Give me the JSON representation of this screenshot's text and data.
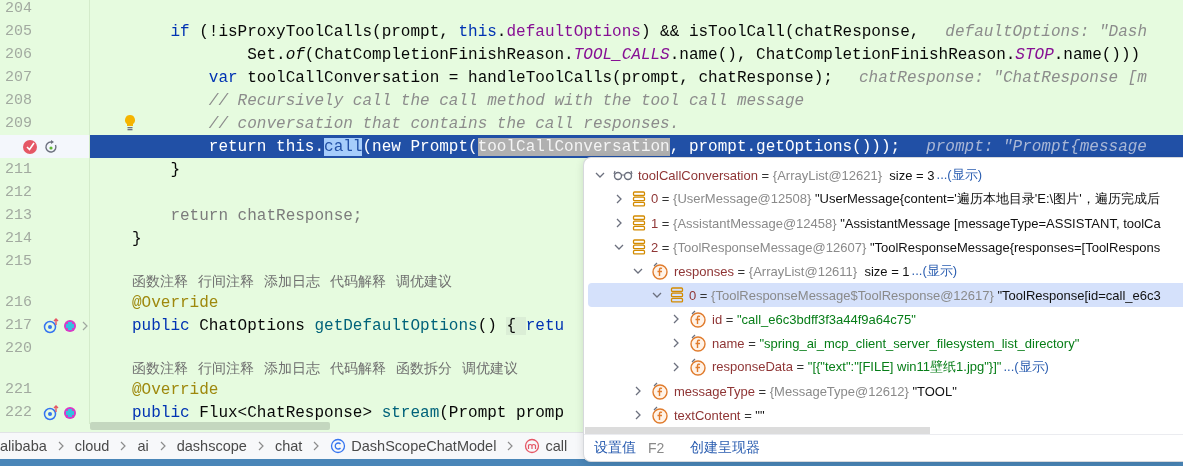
{
  "editor": {
    "lines": [
      {
        "kind": "code",
        "number": "204",
        "current": false
      },
      {
        "kind": "code",
        "number": "205",
        "current": false,
        "tokens": [
          {
            "text": "    if",
            "kind": "keyword"
          },
          {
            "text": " (!isProxyToolCalls(prompt, ",
            "kind": "plain"
          },
          {
            "text": "this",
            "kind": "keyword"
          },
          {
            "text": ".",
            "kind": "plain"
          },
          {
            "text": "defaultOptions",
            "kind": "field"
          },
          {
            "text": ") && isToolCall(chatResponse,",
            "kind": "plain"
          }
        ],
        "hint": "defaultOptions: \"Dash"
      },
      {
        "kind": "code",
        "number": "206",
        "current": false,
        "tokens": [
          {
            "text": "            Set.",
            "kind": "plain"
          },
          {
            "text": "of",
            "kind": "static"
          },
          {
            "text": "(ChatCompletionFinishReason.",
            "kind": "plain"
          },
          {
            "text": "TOOL_CALLS",
            "kind": "constant"
          },
          {
            "text": ".name(), ChatCompletionFinishReason.",
            "kind": "plain"
          },
          {
            "text": "STOP",
            "kind": "constant"
          },
          {
            "text": ".name()))",
            "kind": "plain"
          }
        ]
      },
      {
        "kind": "code",
        "number": "207",
        "current": false,
        "tokens": [
          {
            "text": "        var",
            "kind": "keyword"
          },
          {
            "text": " toolCallConversation = handleToolCalls(prompt, chatResponse);",
            "kind": "plain"
          }
        ],
        "hint": "chatResponse: \"ChatResponse [m"
      },
      {
        "kind": "code",
        "number": "208",
        "current": false,
        "tokens": [
          {
            "text": "        // Recursively call the call method with the tool call message",
            "kind": "comment"
          }
        ]
      },
      {
        "kind": "code",
        "number": "209",
        "current": false,
        "bulb": true,
        "tokens": [
          {
            "text": "        // conversation that contains the call responses.",
            "kind": "comment"
          }
        ]
      },
      {
        "kind": "code",
        "current": true,
        "gutter": [
          {
            "kind": "breakpoint"
          },
          {
            "kind": "reset-frame"
          }
        ],
        "tokens": [
          {
            "text": "        return this.",
            "kind": "plain"
          },
          {
            "text": "call",
            "kind": "match"
          },
          {
            "text": "(new Prompt(",
            "kind": "plain"
          },
          {
            "text": "toolCallConversation",
            "kind": "evaluated"
          },
          {
            "text": ", prompt.getOptions()));",
            "kind": "plain"
          }
        ],
        "hint": "prompt: \"Prompt{message"
      },
      {
        "kind": "code",
        "number": "211",
        "current": false,
        "tokens": [
          {
            "text": "    }",
            "kind": "plain"
          }
        ]
      },
      {
        "kind": "code",
        "number": "212",
        "current": false
      },
      {
        "kind": "code",
        "number": "213",
        "current": false,
        "tokens": [
          {
            "text": "    return chatResponse;",
            "kind": "dim"
          }
        ]
      },
      {
        "kind": "code",
        "number": "214",
        "current": false,
        "tokens": [
          {
            "text": "}",
            "kind": "plain"
          }
        ]
      },
      {
        "kind": "code",
        "number": "215",
        "current": false
      },
      {
        "kind": "actions",
        "items": [
          "函数注释",
          "行间注释",
          "添加日志",
          "代码解释",
          "调优建议"
        ]
      },
      {
        "kind": "code",
        "number": "216",
        "current": false,
        "tokens": [
          {
            "text": "@Override",
            "kind": "annotation"
          }
        ]
      },
      {
        "kind": "code",
        "number": "217",
        "current": false,
        "gutter": [
          {
            "kind": "override"
          },
          {
            "kind": "implemented"
          },
          {
            "kind": "fold"
          }
        ],
        "tokens": [
          {
            "text": "public",
            "kind": "keyword"
          },
          {
            "text": " ChatOptions ",
            "kind": "plain"
          },
          {
            "text": "getDefaultOptions",
            "kind": "declaration"
          },
          {
            "text": "() ",
            "kind": "plain"
          },
          {
            "text": "{ ",
            "kind": "folded"
          },
          {
            "text": "retu",
            "kind": "keyword"
          }
        ]
      },
      {
        "kind": "code",
        "number": "220",
        "current": false
      },
      {
        "kind": "actions",
        "items": [
          "函数注释",
          "行间注释",
          "添加日志",
          "代码解释",
          "函数拆分",
          "调优建议"
        ]
      },
      {
        "kind": "code",
        "number": "221",
        "current": false,
        "tokens": [
          {
            "text": "@Override",
            "kind": "annotation"
          }
        ]
      },
      {
        "kind": "code",
        "number": "222",
        "current": false,
        "gutter": [
          {
            "kind": "override"
          },
          {
            "kind": "implemented"
          }
        ],
        "tokens": [
          {
            "text": "public",
            "kind": "keyword"
          },
          {
            "text": " Flux<ChatResponse> ",
            "kind": "plain"
          },
          {
            "text": "stream",
            "kind": "declaration"
          },
          {
            "text": "(Prompt promp",
            "kind": "plain"
          }
        ]
      }
    ]
  },
  "breadcrumbs": [
    {
      "label": "alibaba",
      "kind": "package"
    },
    {
      "label": "cloud",
      "kind": "package"
    },
    {
      "label": "ai",
      "kind": "package"
    },
    {
      "label": "dashscope",
      "kind": "package"
    },
    {
      "label": "chat",
      "kind": "package"
    },
    {
      "label": "DashScopeChatModel",
      "kind": "class"
    },
    {
      "label": "call",
      "kind": "method"
    }
  ],
  "debugger_popup": {
    "tree": [
      {
        "kind": "watch",
        "name": "toolCallConversation",
        "operator": "=",
        "ref": "{ArrayList@12621}",
        "size": "size = 3",
        "more": "...(显示)",
        "expanded": true,
        "selected": false,
        "children": [
          {
            "kind": "element",
            "name": "0",
            "operator": "=",
            "ref": "{UserMessage@12508}",
            "value": "\"UserMessage{content='遍历本地目录'E:\\图片'，遍历完成后",
            "literal": false,
            "expanded": false,
            "selected": false
          },
          {
            "kind": "element",
            "name": "1",
            "operator": "=",
            "ref": "{AssistantMessage@12458}",
            "value": "\"AssistantMessage [messageType=ASSISTANT, toolCa",
            "literal": false,
            "expanded": false,
            "selected": false
          },
          {
            "kind": "element",
            "name": "2",
            "operator": "=",
            "ref": "{ToolResponseMessage@12607}",
            "value": "\"ToolResponseMessage{responses=[ToolRespons",
            "literal": false,
            "expanded": true,
            "selected": false,
            "children": [
              {
                "kind": "field",
                "name": "responses",
                "operator": "=",
                "ref": "{ArrayList@12611}",
                "size": "size = 1",
                "more": "...(显示)",
                "expanded": true,
                "selected": false,
                "children": [
                  {
                    "kind": "element",
                    "name": "0",
                    "operator": "=",
                    "ref": "{ToolResponseMessage$ToolResponse@12617}",
                    "value": "\"ToolResponse[id=call_e6c3",
                    "literal": false,
                    "expanded": true,
                    "selected": true,
                    "children": [
                      {
                        "kind": "field",
                        "name": "id",
                        "operator": "=",
                        "value": "\"call_e6c3bdff3f3a44f9a64c75\"",
                        "literal": true,
                        "expanded": false,
                        "selected": false
                      },
                      {
                        "kind": "field",
                        "name": "name",
                        "operator": "=",
                        "value": "\"spring_ai_mcp_client_server_filesystem_list_directory\"",
                        "literal": true,
                        "expanded": false,
                        "selected": false
                      },
                      {
                        "kind": "field",
                        "name": "responseData",
                        "operator": "=",
                        "value": "\"[{\"text\":\"[FILE] win11壁纸1.jpg\"}]\"",
                        "literal": true,
                        "more": "...(显示)",
                        "expanded": false,
                        "selected": false
                      }
                    ]
                  }
                ]
              },
              {
                "kind": "field",
                "name": "messageType",
                "operator": "=",
                "ref": "{MessageType@12612}",
                "value": "\"TOOL\"",
                "literal": false,
                "expanded": false,
                "selected": false
              },
              {
                "kind": "field",
                "name": "textContent",
                "operator": "=",
                "value": "\"\"",
                "literal": false,
                "expanded": false,
                "selected": false
              }
            ]
          }
        ]
      }
    ],
    "actions": [
      {
        "label": "设置值",
        "shortcut": "F2"
      },
      {
        "label": "创建呈现器"
      }
    ]
  }
}
